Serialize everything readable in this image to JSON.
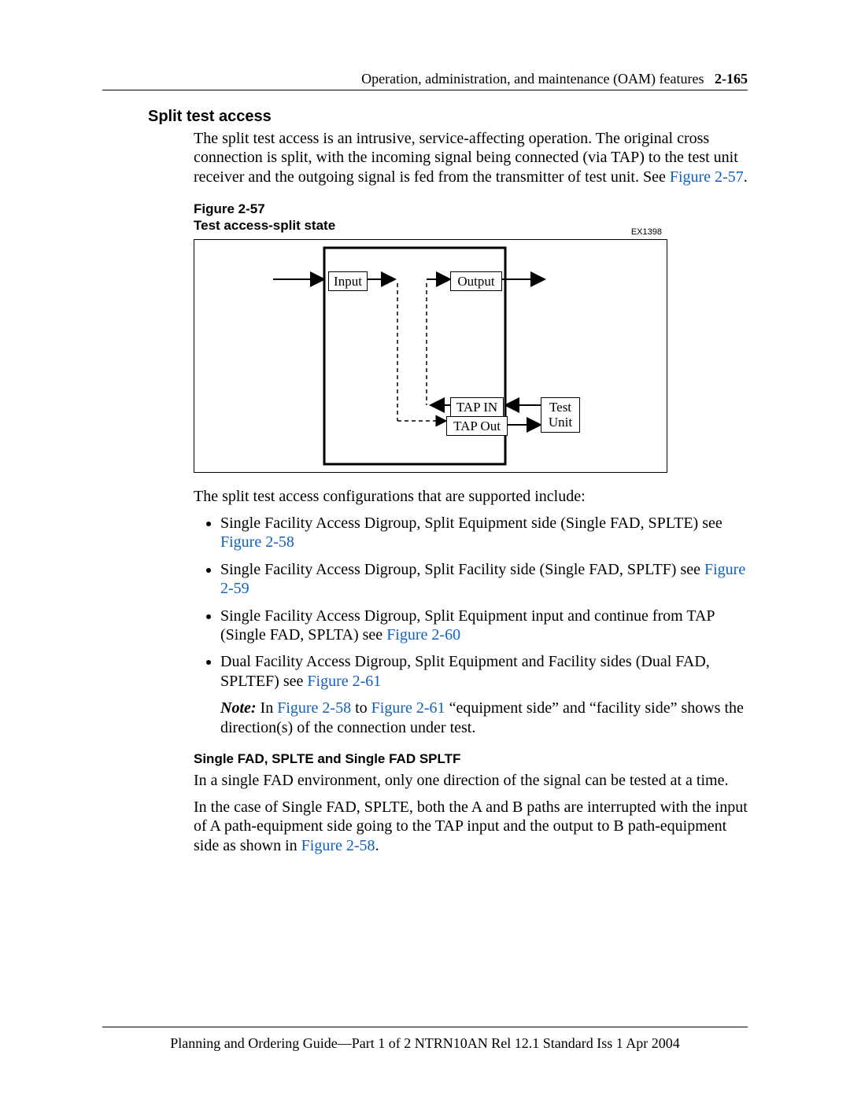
{
  "header": {
    "title": "Operation, administration, and maintenance (OAM) features",
    "page_ref": "2-165"
  },
  "section_title": "Split test access",
  "intro_text_1": "The split test access is an intrusive, service-affecting operation. The original cross connection is split, with the incoming signal being connected (via TAP) to the test unit receiver and the outgoing signal is fed from the transmitter of test unit. See ",
  "intro_link_1": "Figure 2-57",
  "intro_text_1_end": ".",
  "figure_label_1": "Figure 2-57",
  "figure_title_1": "Test access-split state",
  "diagram": {
    "ex_id": "EX1398",
    "input_label": "Input",
    "output_label": "Output",
    "tap_in_label": "TAP IN",
    "tap_out_label": "TAP Out",
    "test_unit_label_1": "Test",
    "test_unit_label_2": "Unit"
  },
  "post_fig_text": "The split test access configurations that are supported include:",
  "bullets": [
    {
      "pre": "Single Facility Access Digroup, Split Equipment side (Single FAD, SPLTE) see ",
      "link": "Figure 2-58",
      "post": ""
    },
    {
      "pre": "Single Facility Access Digroup, Split Facility side (Single FAD, SPLTF) see ",
      "link": "Figure 2-59",
      "post": ""
    },
    {
      "pre": "Single Facility Access Digroup, Split Equipment input and continue from TAP (Single FAD, SPLTA) see ",
      "link": "Figure 2-60",
      "post": ""
    },
    {
      "pre": "Dual Facility Access Digroup, Split Equipment and Facility sides (Dual FAD, SPLTEF) see ",
      "link": "Figure 2-61",
      "post": ""
    }
  ],
  "note": {
    "label": "Note:",
    "pre": "  In ",
    "link1": "Figure 2-58",
    "mid": " to ",
    "link2": "Figure 2-61",
    "post": " “equipment side” and “facility side” shows the direction(s) of the connection under test."
  },
  "subhead": "Single FAD, SPLTE and Single FAD SPLTF",
  "sub_p1": "In a single FAD environment, only one direction of the signal can be tested at a time.",
  "sub_p2_pre": "In the case of Single FAD, SPLTE, both the A and B paths are interrupted with the input of A path-equipment side going to the TAP input and the output to B path-equipment side as shown in ",
  "sub_p2_link": "Figure 2-58",
  "sub_p2_post": ".",
  "footer": "Planning and Ordering Guide—Part 1 of 2   NTRN10AN   Rel 12.1   Standard   Iss 1   Apr 2004"
}
